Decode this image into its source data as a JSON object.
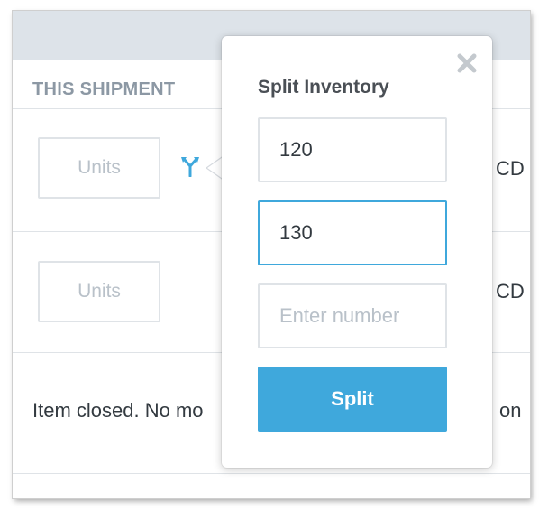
{
  "shipment": {
    "section_title": "THIS SHIPMENT",
    "rows": [
      {
        "units_placeholder": "Units",
        "trailing_text": "CD"
      },
      {
        "units_placeholder": "Units",
        "trailing_text": "CD"
      }
    ],
    "closed_message_left": "Item closed. No mo",
    "closed_message_right": "on"
  },
  "split_popover": {
    "title": "Split Inventory",
    "inputs": [
      {
        "value": "120",
        "placeholder": ""
      },
      {
        "value": "130",
        "placeholder": ""
      },
      {
        "value": "",
        "placeholder": "Enter number"
      }
    ],
    "split_label": "Split",
    "close_icon": "close-icon",
    "accent_color": "#3fa8dc"
  },
  "icons": {
    "split": "split-arrows-icon"
  }
}
